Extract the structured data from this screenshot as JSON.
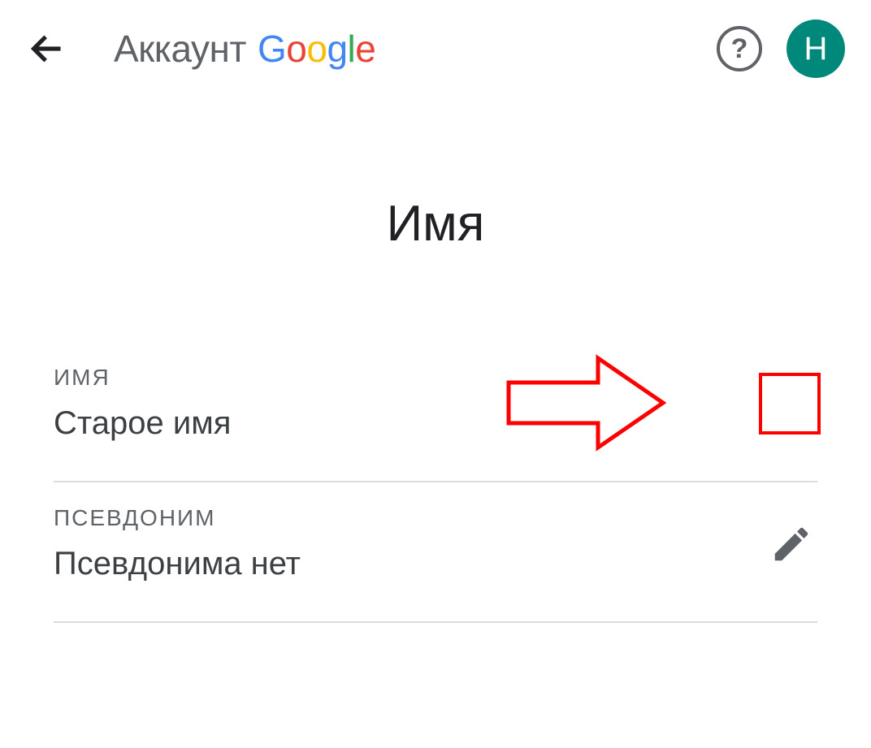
{
  "header": {
    "brand_prefix": "Аккаунт",
    "avatar_initial": "Н"
  },
  "page": {
    "title": "Имя"
  },
  "rows": {
    "name": {
      "label": "ИМЯ",
      "value": "Старое имя"
    },
    "nickname": {
      "label": "ПСЕВДОНИМ",
      "value": "Псевдонима нет"
    }
  }
}
